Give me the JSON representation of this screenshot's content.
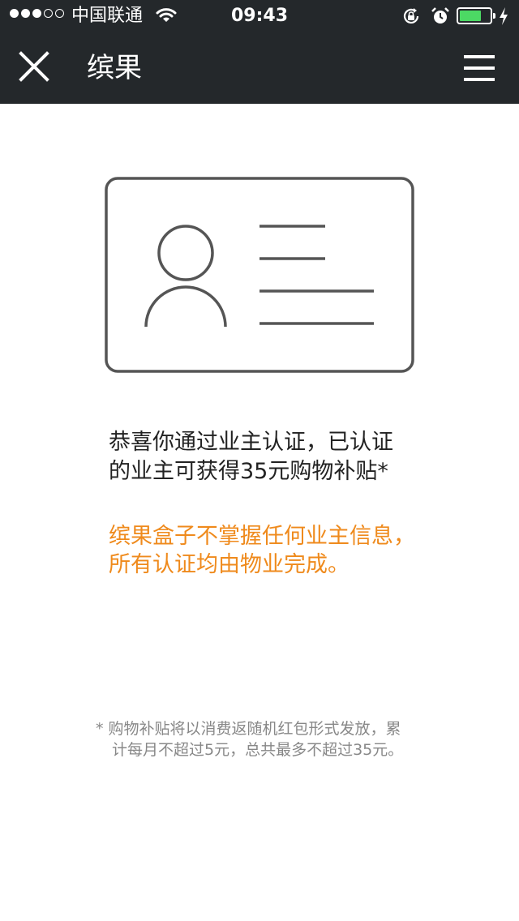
{
  "status_bar": {
    "carrier": "中国联通",
    "time": "09:43",
    "signal_strength": 3,
    "battery_percent": 70
  },
  "nav": {
    "title": "缤果",
    "close_icon": "close-icon",
    "menu_icon": "menu-icon"
  },
  "id_card_icon": "id-card-icon",
  "message": {
    "line1": "恭喜你通过业主认证，已认证",
    "line2": "的业主可获得35元购物补贴*"
  },
  "notice": {
    "line1": "缤果盒子不掌握任何业主信息，",
    "line2": "所有认证均由物业完成。"
  },
  "footnote": {
    "line1": "* 购物补贴将以消费返随机红包形式发放，累",
    "line2": "计每月不超过5元，总共最多不超过35元。"
  },
  "colors": {
    "bar_background": "#24282b",
    "accent_orange": "#ef8a1c",
    "battery_green": "#4cd964",
    "icon_gray": "#555555"
  }
}
